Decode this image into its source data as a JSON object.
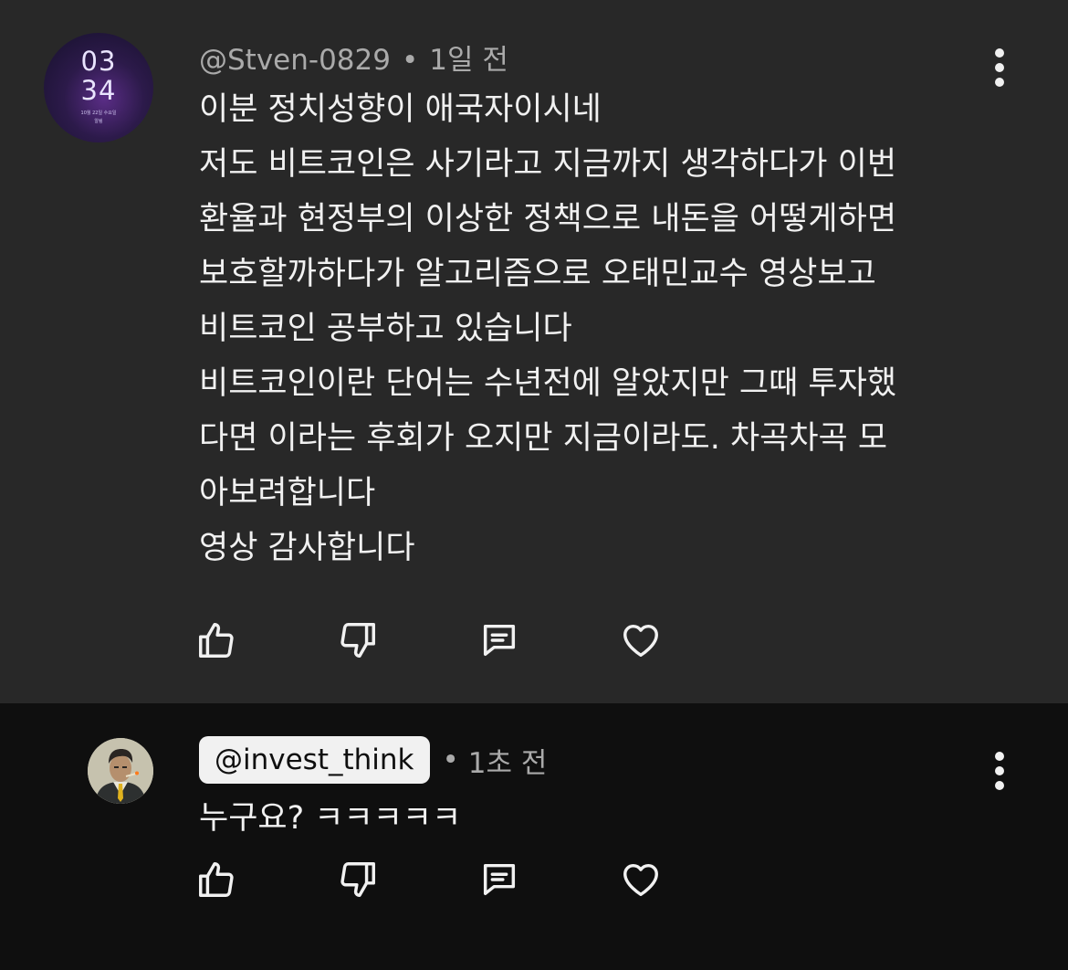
{
  "comments": [
    {
      "avatar": {
        "type": "lock-screen-clock",
        "hour": "03",
        "minute": "34",
        "date": "10월 22일 수요일",
        "sub": "알림"
      },
      "handle": "@Stven-0829",
      "separator": "•",
      "time": "1일 전",
      "lines": [
        "이분 정치성향이 애국자이시네",
        "저도 비트코인은 사기라고 지금까지 생각하다가 이번",
        "환율과 현정부의 이상한 정책으로 내돈을 어떻게하면",
        "보호할까하다가 알고리즘으로 오태민교수 영상보고",
        "비트코인 공부하고 있습니다",
        "비트코인이란 단어는 수년전에 알았지만 그때 투자했",
        "다면 이라는 후회가 오지만 지금이라도. 차곡차곡 모",
        "아보려합니다",
        "영상 감사합니다"
      ],
      "actions": [
        "like-icon",
        "dislike-icon",
        "reply-icon",
        "heart-icon"
      ]
    },
    {
      "avatar": {
        "type": "illustrated-portrait"
      },
      "handle": "@invest_think",
      "separator": "•",
      "time": "1초 전",
      "lines": [
        "누구요? ㅋㅋㅋㅋㅋ"
      ],
      "actions": [
        "like-icon",
        "dislike-icon",
        "reply-icon",
        "heart-icon"
      ]
    }
  ],
  "colors": {
    "primary_bg": "#282828",
    "reply_bg": "#0f0f0f",
    "text": "#f1f1f1",
    "meta": "#aaaaaa",
    "chip_bg": "#f1f1f1"
  }
}
